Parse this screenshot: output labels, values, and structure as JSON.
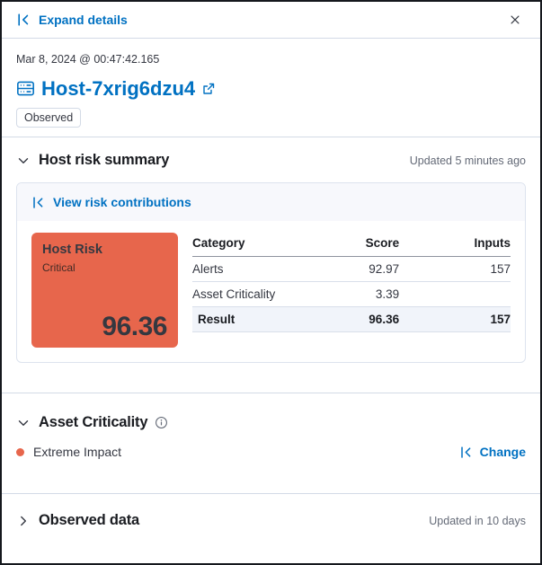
{
  "colors": {
    "link_blue": "#0071c2",
    "risk_critical": "#e7664c",
    "result_row_bg": "#f1f4fa"
  },
  "header": {
    "expand_label": "Expand details",
    "close_icon": "close-icon",
    "collapse_icon": "arrow-start-icon"
  },
  "host": {
    "timestamp": "Mar 8, 2024 @ 00:47:42.165",
    "name": "Host-7xrig6dzu4",
    "badge": "Observed",
    "host_icon": "storage-icon",
    "open_icon": "popout-icon"
  },
  "risk_summary": {
    "title": "Host risk summary",
    "updated": "Updated 5 minutes ago",
    "view_link": "View risk contributions",
    "card": {
      "title": "Host Risk",
      "level": "Critical",
      "score": "96.36"
    },
    "table": {
      "columns": {
        "category": "Category",
        "score": "Score",
        "inputs": "Inputs"
      },
      "rows": [
        {
          "category": "Alerts",
          "score": "92.97",
          "inputs": "157"
        },
        {
          "category": "Asset Criticality",
          "score": "3.39",
          "inputs": ""
        },
        {
          "category": "Result",
          "score": "96.36",
          "inputs": "157"
        }
      ]
    }
  },
  "asset_criticality": {
    "title": "Asset Criticality",
    "value": "Extreme Impact",
    "change_label": "Change"
  },
  "observed_data": {
    "title": "Observed data",
    "updated": "Updated in 10 days"
  }
}
